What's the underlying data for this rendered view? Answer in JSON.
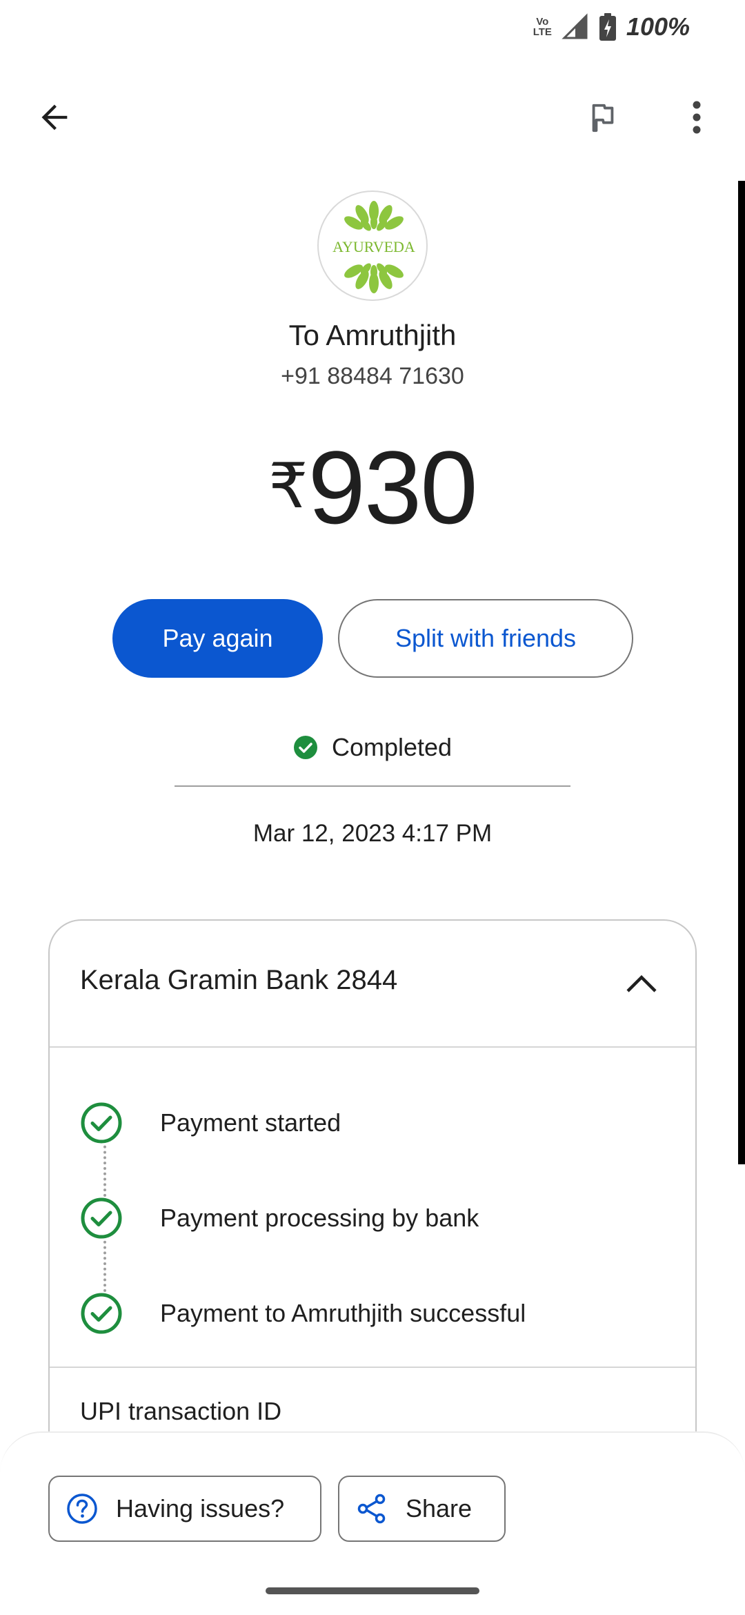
{
  "status_bar": {
    "network_label": "Vo LTE",
    "battery": "100%",
    "icons": [
      "volte-icon",
      "signal-icon",
      "battery-charging-icon"
    ]
  },
  "app_bar": {
    "icons": [
      "back-arrow-icon",
      "flag-icon",
      "more-vert-icon"
    ]
  },
  "payee": {
    "avatar_text": "AYURVEDA",
    "name": "To Amruthjith",
    "phone": "+91 88484 71630"
  },
  "amount": {
    "currency_symbol": "₹",
    "value": "930"
  },
  "actions": {
    "pay_again": "Pay again",
    "split": "Split with friends"
  },
  "transaction": {
    "status": "Completed",
    "datetime": "Mar 12, 2023 4:17 PM"
  },
  "card": {
    "bank": "Kerala Gramin Bank 2844",
    "steps": [
      {
        "label": "Payment started"
      },
      {
        "label": "Payment processing by bank"
      },
      {
        "label": "Payment to Amruthjith successful"
      }
    ],
    "upi_label": "UPI transaction ID"
  },
  "bottom": {
    "issues": "Having issues?",
    "share": "Share"
  },
  "colors": {
    "primary": "#0b57d0",
    "success": "#1e8e3e",
    "avatar_leaf": "#8dc63f"
  }
}
